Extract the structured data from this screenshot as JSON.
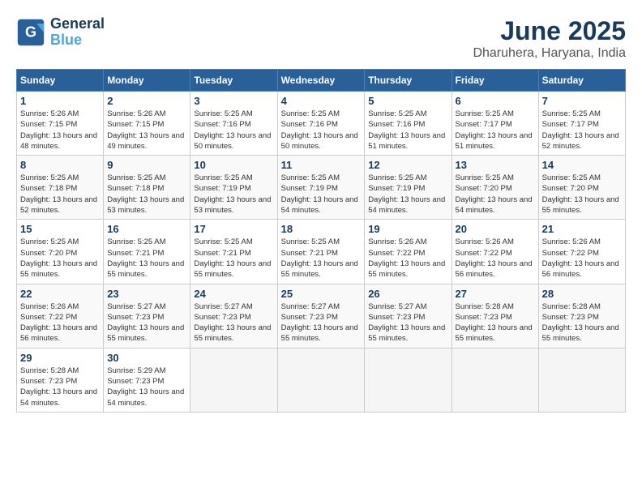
{
  "header": {
    "logo_line1": "General",
    "logo_line2": "Blue",
    "month_year": "June 2025",
    "location": "Dharuhera, Haryana, India"
  },
  "calendar": {
    "days_of_week": [
      "Sunday",
      "Monday",
      "Tuesday",
      "Wednesday",
      "Thursday",
      "Friday",
      "Saturday"
    ],
    "weeks": [
      [
        {
          "day": "",
          "info": ""
        },
        {
          "day": "2",
          "info": "Sunrise: 5:26 AM\nSunset: 7:15 PM\nDaylight: 13 hours\nand 49 minutes."
        },
        {
          "day": "3",
          "info": "Sunrise: 5:25 AM\nSunset: 7:16 PM\nDaylight: 13 hours\nand 50 minutes."
        },
        {
          "day": "4",
          "info": "Sunrise: 5:25 AM\nSunset: 7:16 PM\nDaylight: 13 hours\nand 50 minutes."
        },
        {
          "day": "5",
          "info": "Sunrise: 5:25 AM\nSunset: 7:16 PM\nDaylight: 13 hours\nand 51 minutes."
        },
        {
          "day": "6",
          "info": "Sunrise: 5:25 AM\nSunset: 7:17 PM\nDaylight: 13 hours\nand 51 minutes."
        },
        {
          "day": "7",
          "info": "Sunrise: 5:25 AM\nSunset: 7:17 PM\nDaylight: 13 hours\nand 52 minutes."
        }
      ],
      [
        {
          "day": "1",
          "info": "Sunrise: 5:26 AM\nSunset: 7:15 PM\nDaylight: 13 hours\nand 48 minutes."
        },
        {
          "day": "9",
          "info": "Sunrise: 5:25 AM\nSunset: 7:18 PM\nDaylight: 13 hours\nand 53 minutes."
        },
        {
          "day": "10",
          "info": "Sunrise: 5:25 AM\nSunset: 7:19 PM\nDaylight: 13 hours\nand 53 minutes."
        },
        {
          "day": "11",
          "info": "Sunrise: 5:25 AM\nSunset: 7:19 PM\nDaylight: 13 hours\nand 54 minutes."
        },
        {
          "day": "12",
          "info": "Sunrise: 5:25 AM\nSunset: 7:19 PM\nDaylight: 13 hours\nand 54 minutes."
        },
        {
          "day": "13",
          "info": "Sunrise: 5:25 AM\nSunset: 7:20 PM\nDaylight: 13 hours\nand 54 minutes."
        },
        {
          "day": "14",
          "info": "Sunrise: 5:25 AM\nSunset: 7:20 PM\nDaylight: 13 hours\nand 55 minutes."
        }
      ],
      [
        {
          "day": "8",
          "info": "Sunrise: 5:25 AM\nSunset: 7:18 PM\nDaylight: 13 hours\nand 52 minutes."
        },
        {
          "day": "16",
          "info": "Sunrise: 5:25 AM\nSunset: 7:21 PM\nDaylight: 13 hours\nand 55 minutes."
        },
        {
          "day": "17",
          "info": "Sunrise: 5:25 AM\nSunset: 7:21 PM\nDaylight: 13 hours\nand 55 minutes."
        },
        {
          "day": "18",
          "info": "Sunrise: 5:25 AM\nSunset: 7:21 PM\nDaylight: 13 hours\nand 55 minutes."
        },
        {
          "day": "19",
          "info": "Sunrise: 5:26 AM\nSunset: 7:22 PM\nDaylight: 13 hours\nand 55 minutes."
        },
        {
          "day": "20",
          "info": "Sunrise: 5:26 AM\nSunset: 7:22 PM\nDaylight: 13 hours\nand 56 minutes."
        },
        {
          "day": "21",
          "info": "Sunrise: 5:26 AM\nSunset: 7:22 PM\nDaylight: 13 hours\nand 56 minutes."
        }
      ],
      [
        {
          "day": "15",
          "info": "Sunrise: 5:25 AM\nSunset: 7:20 PM\nDaylight: 13 hours\nand 55 minutes."
        },
        {
          "day": "23",
          "info": "Sunrise: 5:27 AM\nSunset: 7:23 PM\nDaylight: 13 hours\nand 55 minutes."
        },
        {
          "day": "24",
          "info": "Sunrise: 5:27 AM\nSunset: 7:23 PM\nDaylight: 13 hours\nand 55 minutes."
        },
        {
          "day": "25",
          "info": "Sunrise: 5:27 AM\nSunset: 7:23 PM\nDaylight: 13 hours\nand 55 minutes."
        },
        {
          "day": "26",
          "info": "Sunrise: 5:27 AM\nSunset: 7:23 PM\nDaylight: 13 hours\nand 55 minutes."
        },
        {
          "day": "27",
          "info": "Sunrise: 5:28 AM\nSunset: 7:23 PM\nDaylight: 13 hours\nand 55 minutes."
        },
        {
          "day": "28",
          "info": "Sunrise: 5:28 AM\nSunset: 7:23 PM\nDaylight: 13 hours\nand 55 minutes."
        }
      ],
      [
        {
          "day": "22",
          "info": "Sunrise: 5:26 AM\nSunset: 7:22 PM\nDaylight: 13 hours\nand 56 minutes."
        },
        {
          "day": "30",
          "info": "Sunrise: 5:29 AM\nSunset: 7:23 PM\nDaylight: 13 hours\nand 54 minutes."
        },
        {
          "day": "",
          "info": ""
        },
        {
          "day": "",
          "info": ""
        },
        {
          "day": "",
          "info": ""
        },
        {
          "day": "",
          "info": ""
        },
        {
          "day": ""
        }
      ],
      [
        {
          "day": "29",
          "info": "Sunrise: 5:28 AM\nSunset: 7:23 PM\nDaylight: 13 hours\nand 54 minutes."
        },
        {
          "day": "",
          "info": ""
        },
        {
          "day": "",
          "info": ""
        },
        {
          "day": "",
          "info": ""
        },
        {
          "day": "",
          "info": ""
        },
        {
          "day": "",
          "info": ""
        },
        {
          "day": "",
          "info": ""
        }
      ]
    ]
  }
}
